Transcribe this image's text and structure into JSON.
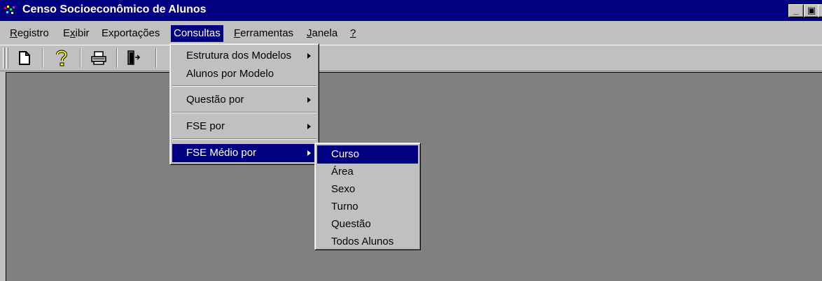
{
  "window": {
    "title": "Censo Socioeconômico de Alunos",
    "minimize_glyph": "_",
    "maximize_glyph": "▣",
    "close_glyph": "✕",
    "title_bar_color": "#000080",
    "client_color": "#808080"
  },
  "menubar": {
    "items": [
      {
        "label": "Registro",
        "underline": "R",
        "rest": "egistro"
      },
      {
        "label": "Exibir",
        "pre": "E",
        "underline": "x",
        "rest": "ibir"
      },
      {
        "label": "Exportações"
      },
      {
        "label": "Consultas",
        "active": true
      },
      {
        "label": "Ferramentas",
        "underline": "F",
        "rest": "erramentas"
      },
      {
        "label": "Janela",
        "underline": "J",
        "rest": "anela"
      },
      {
        "label": "?",
        "underline": "?"
      }
    ]
  },
  "toolbar": {
    "buttons": [
      {
        "icon": "new-document-icon"
      },
      {
        "icon": "help-icon"
      },
      {
        "icon": "printer-icon"
      },
      {
        "icon": "exit-door-icon"
      }
    ]
  },
  "consultas_menu": {
    "items": [
      {
        "label": "Estrutura dos Modelos",
        "submenu": true
      },
      {
        "label": "Alunos por Modelo",
        "submenu": false
      },
      {
        "label": "Questão por",
        "submenu": true
      },
      {
        "label": "FSE por",
        "submenu": true
      },
      {
        "label": "FSE Médio por",
        "submenu": true,
        "active": true
      }
    ]
  },
  "fse_medio_submenu": {
    "items": [
      {
        "label": "Curso",
        "active": true
      },
      {
        "label": "Área"
      },
      {
        "label": "Sexo"
      },
      {
        "label": "Turno"
      },
      {
        "label": "Questão"
      },
      {
        "label": "Todos Alunos"
      }
    ]
  },
  "colors": {
    "highlight": "#000080",
    "face": "#c0c0c0"
  }
}
